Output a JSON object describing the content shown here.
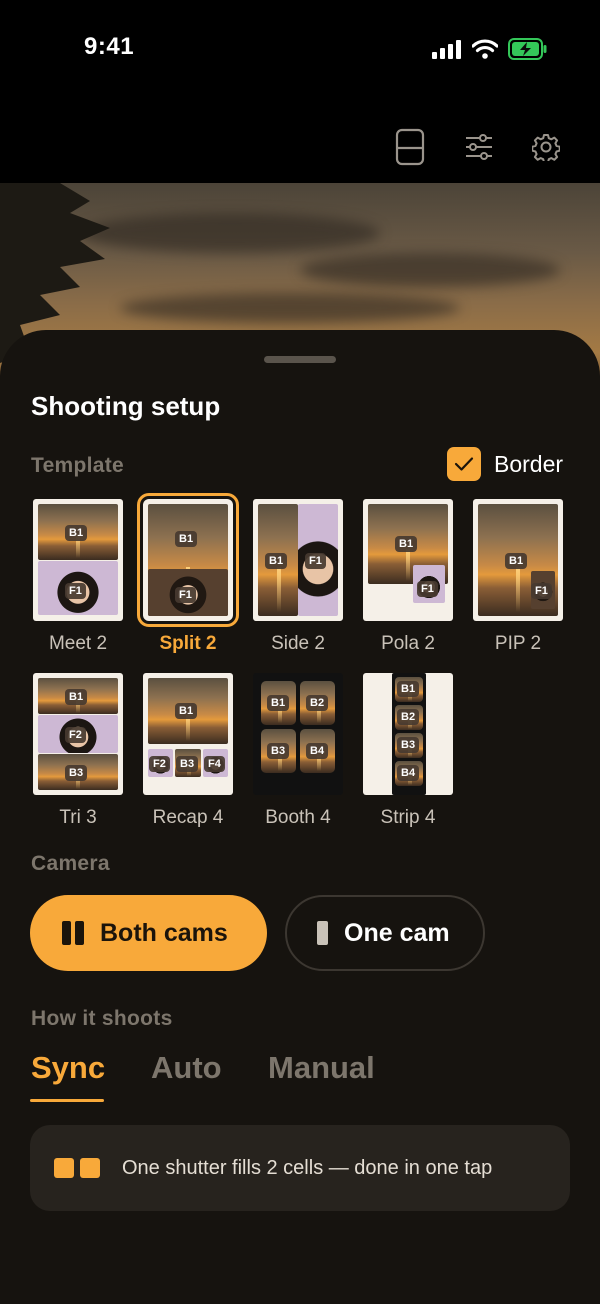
{
  "status_bar": {
    "time": "9:41"
  },
  "sheet": {
    "title": "Shooting setup"
  },
  "template_section": {
    "label": "Template",
    "border_label": "Border",
    "border_checked": true,
    "items": [
      {
        "label": "Meet 2",
        "tags": [
          "B1",
          "F1"
        ]
      },
      {
        "label": "Split 2",
        "tags": [
          "B1",
          "F1"
        ],
        "selected": true
      },
      {
        "label": "Side 2",
        "tags": [
          "B1",
          "F1"
        ]
      },
      {
        "label": "Pola 2",
        "tags": [
          "B1",
          "F1"
        ]
      },
      {
        "label": "PIP 2",
        "tags": [
          "B1",
          "F1"
        ]
      },
      {
        "label": "Tri 3",
        "tags": [
          "B1",
          "F2",
          "B3"
        ]
      },
      {
        "label": "Recap 4",
        "tags": [
          "B1",
          "F2",
          "B3",
          "F4"
        ]
      },
      {
        "label": "Booth 4",
        "tags": [
          "B1",
          "B2",
          "B3",
          "B4"
        ]
      },
      {
        "label": "Strip 4",
        "tags": [
          "B1",
          "B2",
          "B3",
          "B4"
        ]
      }
    ]
  },
  "camera_section": {
    "label": "Camera",
    "options": [
      {
        "label": "Both cams",
        "selected": true
      },
      {
        "label": "One cam",
        "selected": false
      }
    ]
  },
  "shoot_section": {
    "label": "How it shoots",
    "tabs": [
      {
        "label": "Sync",
        "active": true
      },
      {
        "label": "Auto",
        "active": false
      },
      {
        "label": "Manual",
        "active": false
      }
    ],
    "info": "One shutter fills 2 cells — done in one tap"
  },
  "colors": {
    "accent": "#f8a93a",
    "sheet_bg": "#16130f",
    "muted": "#7d766c"
  }
}
